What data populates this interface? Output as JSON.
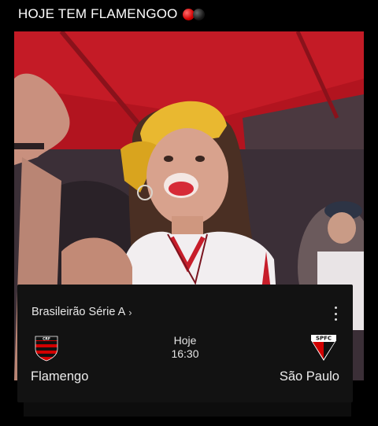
{
  "header": {
    "title": "HOJE TEM FLAMENGOO"
  },
  "photo": {
    "description_icon": "fan-photo"
  },
  "match_card": {
    "competition": "Brasileirão Série A",
    "chevron": "›",
    "day": "Hoje",
    "time": "16:30",
    "home_team": "Flamengo",
    "away_team": "São Paulo",
    "away_crest_text": "SPFC"
  },
  "colors": {
    "flamengo_red": "#d10000",
    "flamengo_black": "#000000",
    "card_bg": "#121212"
  }
}
